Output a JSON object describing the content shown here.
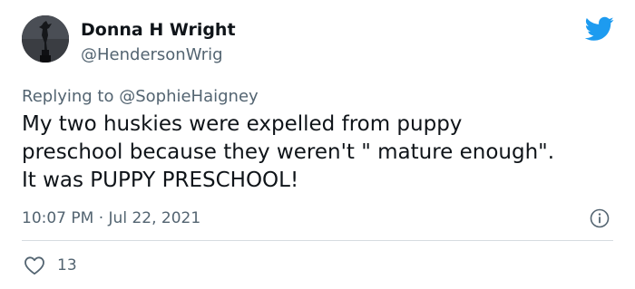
{
  "tweet": {
    "author": {
      "display_name": "Donna H Wright",
      "handle": "@HendersonWrig"
    },
    "reply_prefix": "Replying to ",
    "reply_to": "@SophieHaigney",
    "text_lines": [
      "My two huskies were expelled from puppy",
      "preschool because they weren't \" mature enough\".",
      "It was PUPPY PRESCHOOL!"
    ],
    "timestamp": "10:07 PM · Jul 22, 2021",
    "likes": "13"
  },
  "icons": {
    "logo": "twitter-bird-icon",
    "info": "info-icon",
    "like": "heart-icon"
  },
  "colors": {
    "brand": "#1d9bf0",
    "text": "#0f1419",
    "secondary": "#536471"
  }
}
